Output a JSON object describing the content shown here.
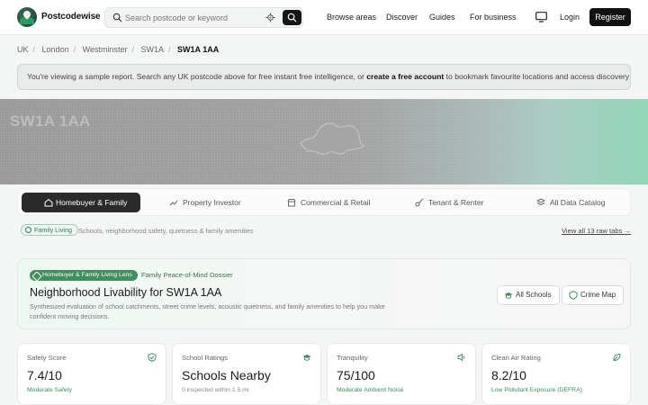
{
  "brand": {
    "name": "Postcodewise"
  },
  "search": {
    "placeholder": "Search postcode or keyword"
  },
  "nav": {
    "links": [
      "Browse areas",
      "Discover",
      "Guides",
      "For business"
    ],
    "login": "Login",
    "register": "Register"
  },
  "breadcrumb": [
    "UK",
    "London",
    "Westminster",
    "SW1A",
    "SW1A 1AA"
  ],
  "notice": {
    "before": "You're viewing a sample report. Search any UK postcode above for free instant free intelligence, or ",
    "link": "create a free account",
    "after": " to bookmark favourite locations and access discovery tools."
  },
  "hero": {
    "title": "SW1A 1AA"
  },
  "tabs": [
    {
      "label": "Homebuyer & Family",
      "icon": "house-icon"
    },
    {
      "label": "Property Investor",
      "icon": "trend-up-icon"
    },
    {
      "label": "Commercial & Retail",
      "icon": "store-icon"
    },
    {
      "label": "Tenant & Renter",
      "icon": "key-icon"
    },
    {
      "label": "All Data Catalog",
      "icon": "layers-icon"
    }
  ],
  "lens_bar": {
    "pill": "Family Living",
    "description": "Schools, neighborhood safety, quietness & family amenities",
    "view_all": "View all 13 raw tabs →"
  },
  "dossier": {
    "badge": "Homebuyer & Family Living Lens",
    "tag": "Family Peace-of-Mind Dossier",
    "title": "Neighborhood Livability for SW1A 1AA",
    "description": "Synthesized evaluation of school catchments, street crime levels, acoustic quietness, and family amenities to help you make confident moving decisions.",
    "buttons": [
      {
        "label": "All Schools",
        "icon": "graduation-cap-icon"
      },
      {
        "label": "Crime Map",
        "icon": "shield-icon"
      }
    ]
  },
  "cards": [
    {
      "label": "Safety Score",
      "value": "7.4/10",
      "sub": "Moderate Safety",
      "icon": "shield-check-icon"
    },
    {
      "label": "School Ratings",
      "value": "Schools Nearby",
      "sub": "0 inspected within 1.5 mi",
      "icon": "graduation-cap-icon"
    },
    {
      "label": "Tranquility",
      "value": "75/100",
      "sub": "Moderate Ambient Noise",
      "icon": "speaker-icon"
    },
    {
      "label": "Clean Air Rating",
      "value": "8.2/10",
      "sub": "Low Pollutant Exposure (DEFRA)",
      "icon": "leaf-icon"
    }
  ],
  "colors": {
    "accent": "#3f8f5f",
    "dark": "#111111"
  }
}
